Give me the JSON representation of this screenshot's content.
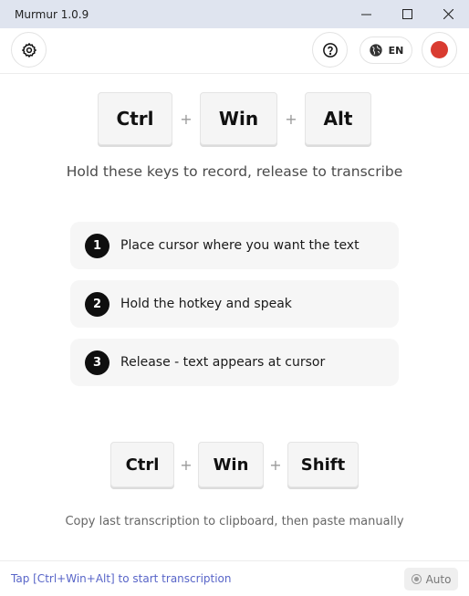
{
  "window": {
    "title": "Murmur 1.0.9",
    "controls": [
      "minimize-icon",
      "maximize-icon",
      "close-icon"
    ]
  },
  "toolbar": {
    "settings_icon": "gear-icon",
    "help_icon": "question-circle-icon",
    "language": {
      "icon": "globe-icon",
      "label": "EN"
    },
    "record_indicator_color": "#d93b30"
  },
  "record_hotkey": {
    "keys": [
      "Ctrl",
      "Win",
      "Alt"
    ],
    "separator": "+",
    "caption": "Hold these keys to record, release to transcribe"
  },
  "steps": [
    {
      "number": "1",
      "text": "Place cursor where you want the text"
    },
    {
      "number": "2",
      "text": "Hold the hotkey and speak"
    },
    {
      "number": "3",
      "text": "Release - text appears at cursor"
    }
  ],
  "copy_hotkey": {
    "keys": [
      "Ctrl",
      "Win",
      "Shift"
    ],
    "separator": "+",
    "caption": "Copy last transcription to clipboard, then paste manually"
  },
  "status": {
    "text": "Tap [Ctrl+Win+Alt] to start transcription",
    "text_color": "#5865c8",
    "mode_label": "Auto",
    "mode_icon": "radio-dot-icon"
  }
}
